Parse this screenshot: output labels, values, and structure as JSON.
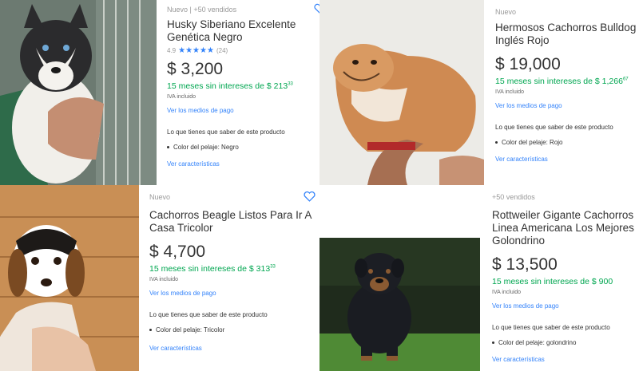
{
  "colors": {
    "link": "#3483fa",
    "installments": "#00a650",
    "star": "#3483fa"
  },
  "cards": [
    {
      "condition": "Nuevo",
      "sold": "+50 vendidos",
      "title": "Husky Siberiano Excelente Genética Negro",
      "rating": "4.9",
      "stars": "★★★★★",
      "reviews": "(24)",
      "price": "$ 3,200",
      "installments": "15 meses sin intereses de $ 213",
      "installments_cents": "33",
      "iva": "IVA incluido",
      "payment_link": "Ver los medios de pago",
      "know_title": "Lo que tienes que saber de este producto",
      "attribute": "Color del pelaje: Negro",
      "features_link": "Ver características"
    },
    {
      "condition": "Nuevo",
      "title": "Hermosos Cachorros Bulldog Inglés Rojo",
      "price": "$ 19,000",
      "installments": "15 meses sin intereses de $ 1,266",
      "installments_cents": "67",
      "iva": "IVA incluido",
      "payment_link": "Ver los medios de pago",
      "know_title": "Lo que tienes que saber de este producto",
      "attribute": "Color del pelaje: Rojo",
      "features_link": "Ver características"
    },
    {
      "condition": "Nuevo",
      "title": "Cachorros Beagle Listos Para Ir A Casa Tricolor",
      "price": "$ 4,700",
      "installments": "15 meses sin intereses de $ 313",
      "installments_cents": "33",
      "iva": "IVA incluido",
      "payment_link": "Ver los medios de pago",
      "know_title": "Lo que tienes que saber de este producto",
      "attribute": "Color del pelaje: Tricolor",
      "features_link": "Ver características"
    },
    {
      "sold": "+50 vendidos",
      "title": "Rottweiler Gigante Cachorros Linea Americana Los Mejores Golondrino",
      "price": "$ 13,500",
      "installments": "15 meses sin intereses de $ 900",
      "iva": "IVA incluido",
      "payment_link": "Ver los medios de pago",
      "know_title": "Lo que tienes que saber de este producto",
      "attribute": "Color del pelaje: golondrino",
      "features_link": "Ver características"
    }
  ]
}
